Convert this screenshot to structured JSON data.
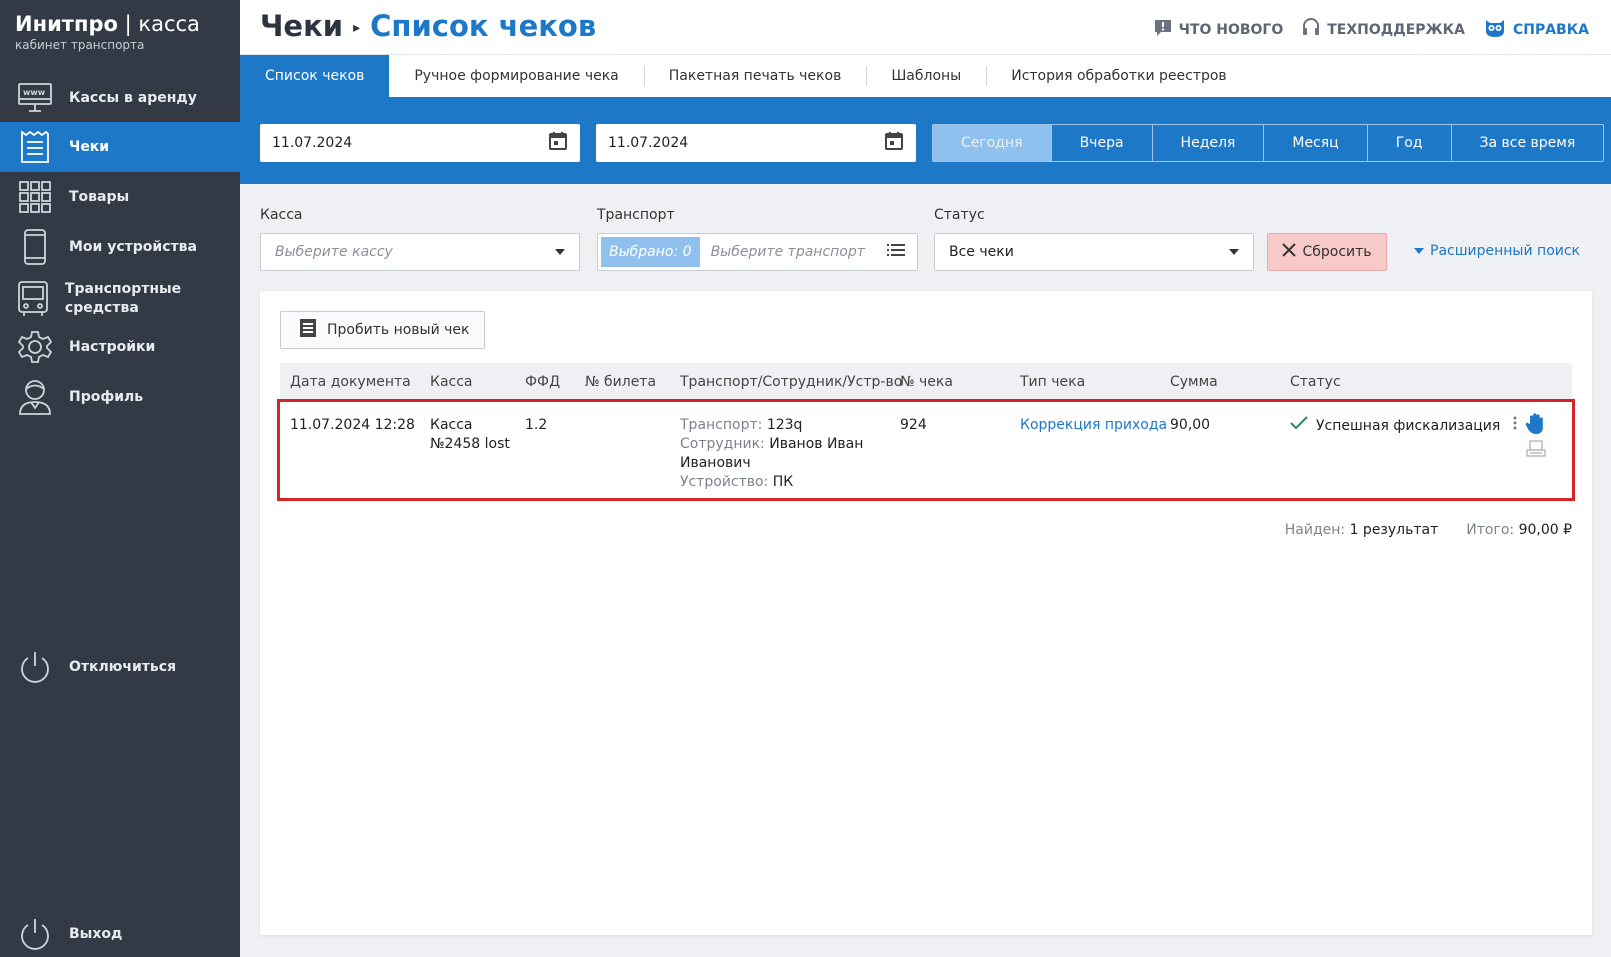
{
  "app": {
    "brand_bold": "Инитпро",
    "brand_sep": "|",
    "brand_light": "касса",
    "brand_sub": "кабинет транспорта"
  },
  "sidebar": {
    "items": [
      {
        "label": "Кассы в аренду",
        "icon": "www-monitor-icon"
      },
      {
        "label": "Чеки",
        "icon": "receipt-icon",
        "active": true
      },
      {
        "label": "Товары",
        "icon": "grid-icon"
      },
      {
        "label": "Мои устройства",
        "icon": "phone-icon"
      },
      {
        "label": "Транспортные средства",
        "icon": "bus-icon"
      },
      {
        "label": "Настройки",
        "icon": "gear-icon"
      },
      {
        "label": "Профиль",
        "icon": "user-icon"
      }
    ],
    "disconnect": "Отключиться",
    "logout": "Выход"
  },
  "header": {
    "crumb_parent": "Чеки",
    "crumb_current": "Список чеков",
    "links": {
      "news": "ЧТО НОВОГО",
      "support": "ТЕХПОДДЕРЖКА",
      "help": "СПРАВКА"
    }
  },
  "tabs": [
    "Список чеков",
    "Ручное формирование чека",
    "Пакетная печать чеков",
    "Шаблоны",
    "История обработки реестров"
  ],
  "dates": {
    "from": "11.07.2024",
    "to": "11.07.2024"
  },
  "periods": [
    "Сегодня",
    "Вчера",
    "Неделя",
    "Месяц",
    "Год",
    "За все время"
  ],
  "filters": {
    "kassa_label": "Касса",
    "kassa_placeholder": "Выберите кассу",
    "transport_label": "Транспорт",
    "transport_chip": "Выбрано: 0",
    "transport_placeholder": "Выберите транспорт",
    "status_label": "Статус",
    "status_value": "Все чеки",
    "reset": "Сбросить",
    "advanced": "Расширенный поиск"
  },
  "table": {
    "new_check_button": "Пробить новый чек",
    "headers": {
      "date": "Дата документа",
      "kassa": "Касса",
      "ffd": "ФФД",
      "ticket": "№ билета",
      "transport": "Транспорт/Сотрудник/Устр-во",
      "number": "№ чека",
      "type": "Тип чека",
      "sum": "Сумма",
      "status": "Статус"
    },
    "rows": [
      {
        "date": "11.07.2024 12:28",
        "kassa_line1": "Касса",
        "kassa_line2": "№2458 lost",
        "ffd": "1.2",
        "ticket": "",
        "transport_label": "Транспорт:",
        "transport_value": "123q",
        "employee_label": "Сотрудник:",
        "employee_value_1": "Иванов Иван",
        "employee_value_2": "Иванович",
        "device_label": "Устройство:",
        "device_value": "ПК",
        "number": "924",
        "type": "Коррекция прихода",
        "sum": "90,00",
        "status": "Успешная фискализация"
      }
    ],
    "found_label": "Найден:",
    "found_value": "1 результат",
    "total_label": "Итого:",
    "total_value": "90,00 ₽"
  },
  "colors": {
    "sidebar_bg": "#333a46",
    "accent": "#1e78c8",
    "highlight": "#d6242b"
  }
}
